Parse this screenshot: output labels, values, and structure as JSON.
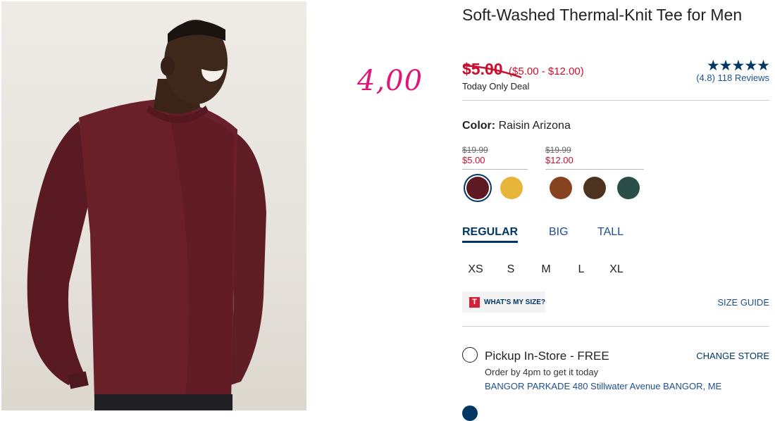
{
  "overlay": {
    "handwritten_price": "4,00"
  },
  "product": {
    "title": "Soft-Washed Thermal-Knit Tee for Men",
    "sale_price": "$5.00",
    "price_range": "($5.00 - $12.00)",
    "deal_label": "Today Only Deal",
    "rating": {
      "stars": "★★★★★",
      "value": 4.8,
      "text": "(4.8) 118 Reviews"
    }
  },
  "color": {
    "label": "Color:",
    "selected_name": "Raisin Arizona",
    "price_groups": [
      {
        "was": "$19.99",
        "now": "$5.00"
      },
      {
        "was": "$19.99",
        "now": "$12.00"
      }
    ],
    "swatches": [
      {
        "name": "Raisin Arizona",
        "color": "#5e1a22",
        "selected": true
      },
      {
        "name": "mustard",
        "color": "#e6b53a",
        "selected": false
      },
      {
        "name": "rust brown",
        "color": "#874220",
        "selected": false
      },
      {
        "name": "dark brown",
        "color": "#4c3320",
        "selected": false
      },
      {
        "name": "dark teal",
        "color": "#2c4e4a",
        "selected": false
      }
    ]
  },
  "fit": {
    "tabs": [
      "REGULAR",
      "BIG",
      "TALL"
    ],
    "active": "REGULAR"
  },
  "sizes": [
    "XS",
    "S",
    "M",
    "L",
    "XL"
  ],
  "size_tools": {
    "whats_my_size_logo": "T",
    "whats_my_size": "WHAT'S MY SIZE?",
    "size_guide": "SIZE GUIDE"
  },
  "fulfillment": {
    "pickup_title": "Pickup In-Store - FREE",
    "change_store": "CHANGE STORE",
    "order_by": "Order by 4pm to get it today",
    "store_address": "BANGOR PARKADE 480 Stillwater Avenue  BANGOR, ME"
  },
  "colors": {
    "sale_red": "#c8102e",
    "navy": "#003764",
    "link_blue": "#1d4f91",
    "overlay_pink": "#e0157a"
  }
}
